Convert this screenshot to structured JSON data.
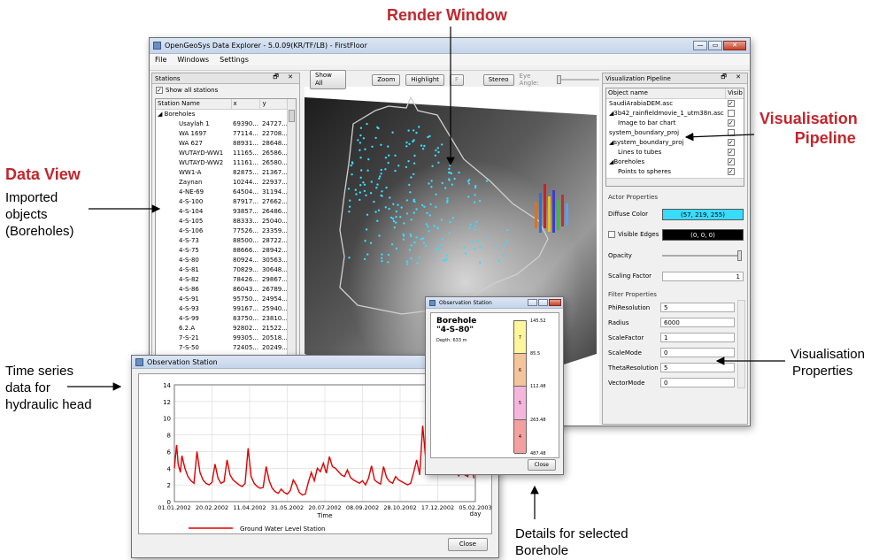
{
  "annotations": {
    "render_window": "Render Window",
    "vis_pipeline_line1": "Visualisation",
    "vis_pipeline_line2": "Pipeline",
    "data_view": "Data View",
    "imported": [
      "Imported",
      "objects",
      "(Boreholes)"
    ],
    "time_series": [
      "Time series",
      "data for",
      "hydraulic head"
    ],
    "vis_properties": [
      "Visualisation",
      "Properties"
    ],
    "details": [
      "Details for selected",
      "Borehole"
    ]
  },
  "main_window": {
    "title": "OpenGeoSys Data Explorer - 5.0.09(KR/TF/LB) - FirstFloor",
    "menu": [
      "File",
      "Windows",
      "Settings"
    ],
    "controls": {
      "minimize": "—",
      "maximize": "▭",
      "close": "✕"
    }
  },
  "stations": {
    "header": "Stations",
    "dock_controls": "🗗 ✕",
    "show_all_label": "Show all stations",
    "columns": [
      "Station Name",
      "x",
      "y"
    ],
    "group": "Boreholes",
    "rows": [
      [
        "Usaylah 1",
        "69390...",
        "24727..."
      ],
      [
        "WA 1697",
        "77114...",
        "22708..."
      ],
      [
        "WA 627",
        "88931...",
        "28648..."
      ],
      [
        "WUTAYD-WW1",
        "11165...",
        "26586..."
      ],
      [
        "WUTAYD-WW2",
        "11161...",
        "26580..."
      ],
      [
        "WW1-A",
        "82875...",
        "21367..."
      ],
      [
        "Zaynan",
        "10244...",
        "22937..."
      ],
      [
        "4-NE-69",
        "64504...",
        "31194..."
      ],
      [
        "4-S-100",
        "87917...",
        "27662..."
      ],
      [
        "4-S-104",
        "93857...",
        "26486..."
      ],
      [
        "4-S-105",
        "88333...",
        "25040..."
      ],
      [
        "4-S-106",
        "77526...",
        "23359..."
      ],
      [
        "4-S-73",
        "88500...",
        "28722..."
      ],
      [
        "4-S-75",
        "88666...",
        "28942..."
      ],
      [
        "4-S-80",
        "80924...",
        "30563..."
      ],
      [
        "4-S-81",
        "70829...",
        "30648..."
      ],
      [
        "4-S-82",
        "78426...",
        "29867..."
      ],
      [
        "4-S-86",
        "86043...",
        "26789..."
      ],
      [
        "4-S-91",
        "95750...",
        "24954..."
      ],
      [
        "4-S-93",
        "99167...",
        "25940..."
      ],
      [
        "4-S-99",
        "83750...",
        "23810..."
      ],
      [
        "6.2.A",
        "92802...",
        "21522..."
      ],
      [
        "7-S-21",
        "99305...",
        "20518..."
      ],
      [
        "7-S-50",
        "72405...",
        "20249..."
      ]
    ]
  },
  "toolbar": {
    "show_all": "Show All",
    "zoom": "Zoom",
    "highlight": "Highlight",
    "f": "F",
    "stereo": "Stereo",
    "eye_angle": "Eye Angle:"
  },
  "pipeline": {
    "header": "Visualization Pipeline",
    "dock_controls": "🗗 ✕",
    "columns": [
      "Object name",
      "Visib"
    ],
    "items": [
      {
        "name": "SaudiArabiaDEM.asc",
        "indent": 0,
        "checked": true
      },
      {
        "name": "◢3b42_rainfieldmovie_1_utm38n.asc",
        "indent": 0,
        "checked": false
      },
      {
        "name": "Image to bar chart",
        "indent": 1,
        "checked": true
      },
      {
        "name": "system_boundary_proj",
        "indent": 0,
        "checked": false
      },
      {
        "name": "◢system_boundary_proj",
        "indent": 0,
        "checked": true
      },
      {
        "name": "Lines to tubes",
        "indent": 1,
        "checked": true
      },
      {
        "name": "◢Boreholes",
        "indent": 0,
        "checked": true
      },
      {
        "name": "Points to spheres",
        "indent": 1,
        "checked": true
      }
    ],
    "actor_props": "Actor Properties",
    "diffuse_label": "Diffuse Color",
    "diffuse_value": "(57, 219, 255)",
    "visible_edges_label": "Visible Edges",
    "edges_value": "(0, 0, 0)",
    "opacity_label": "Opacity",
    "scaling_label": "Scaling Factor",
    "scaling_value": "1",
    "filter_props": "Filter Properties",
    "filters": [
      {
        "label": "PhiResolution",
        "value": "5"
      },
      {
        "label": "Radius",
        "value": "6000"
      },
      {
        "label": "ScaleFactor",
        "value": "1"
      },
      {
        "label": "ScaleMode",
        "value": "0"
      },
      {
        "label": "ThetaResolution",
        "value": "5"
      },
      {
        "label": "VectorMode",
        "value": "0"
      }
    ],
    "colors": {
      "diffuse": "#39dbff",
      "edges": "#000000"
    }
  },
  "obs_window": {
    "title": "Observation Station",
    "close": "Close",
    "legend": "Ground Water Level Station"
  },
  "chart_data": {
    "type": "line",
    "title": "",
    "xlabel": "Time",
    "ylabel": "",
    "x_unit_label": "day",
    "x_ticks": [
      "01.01.2002",
      "20.02.2002",
      "11.04.2002",
      "31.05.2002",
      "20.07.2002",
      "08.09.2002",
      "28.10.2002",
      "17.12.2002",
      "05.02.2003"
    ],
    "y_ticks": [
      0,
      2,
      4,
      6,
      8,
      10,
      12,
      14
    ],
    "ylim": [
      0,
      14
    ],
    "xlim": [
      0,
      400
    ],
    "series": [
      {
        "name": "Ground Water Level Station",
        "color": "#e00000",
        "x": [
          0,
          3,
          5,
          8,
          10,
          14,
          18,
          22,
          26,
          30,
          34,
          38,
          42,
          46,
          50,
          54,
          58,
          62,
          66,
          70,
          74,
          78,
          82,
          86,
          90,
          94,
          98,
          102,
          106,
          110,
          114,
          118,
          122,
          126,
          130,
          134,
          138,
          142,
          146,
          150,
          154,
          158,
          162,
          166,
          170,
          174,
          178,
          182,
          186,
          190,
          194,
          198,
          202,
          206,
          210,
          214,
          218,
          222,
          226,
          230,
          234,
          238,
          242,
          246,
          250,
          254,
          258,
          262,
          266,
          270,
          274,
          278,
          282,
          286,
          290,
          294,
          298,
          302,
          306,
          310,
          314,
          318,
          322,
          326,
          330,
          334,
          338,
          342,
          346,
          350,
          354,
          358,
          362,
          366,
          370,
          374,
          378,
          382,
          386,
          390,
          394,
          398
        ],
        "values": [
          4.0,
          6.8,
          4.5,
          3.5,
          5.5,
          4.0,
          3.0,
          2.5,
          2.2,
          6.0,
          3.5,
          2.6,
          2.2,
          2.0,
          2.3,
          4.5,
          2.8,
          2.2,
          2.4,
          5.0,
          3.2,
          2.6,
          2.3,
          2.0,
          1.8,
          2.2,
          6.4,
          3.0,
          2.2,
          1.8,
          1.6,
          1.7,
          4.2,
          2.5,
          1.6,
          1.2,
          1.0,
          1.5,
          1.1,
          0.9,
          1.3,
          2.6,
          2.0,
          1.1,
          0.8,
          0.9,
          2.3,
          3.5,
          2.5,
          4.0,
          3.6,
          4.6,
          3.4,
          5.4,
          4.2,
          4.0,
          3.6,
          3.2,
          3.0,
          3.8,
          2.9,
          2.6,
          2.4,
          2.2,
          2.5,
          2.0,
          2.8,
          4.3,
          2.6,
          2.3,
          2.1,
          4.2,
          2.9,
          2.4,
          2.2,
          3.0,
          2.6,
          2.4,
          2.2,
          2.0,
          2.2,
          3.5,
          5.0,
          3.2,
          9.1,
          5.2,
          4.2,
          3.2,
          7.8,
          4.6,
          3.6,
          6.2,
          4.2,
          3.6,
          3.3,
          3.6,
          3.1,
          4.0,
          3.2,
          3.0,
          5.0,
          2.8
        ]
      }
    ]
  },
  "borehole_window": {
    "title": "Observation Station",
    "name_label": "Borehole",
    "name": "\"4-S-80\"",
    "depth": "Depth: 633 m",
    "close": "Close",
    "layers": [
      {
        "label": "7",
        "color": "#fff59a",
        "top": "145.52"
      },
      {
        "label": "6",
        "color": "#f5c49b",
        "top": "85.5"
      },
      {
        "label": "5",
        "color": "#f6b6dc",
        "top": "112.48"
      },
      {
        "label": "4",
        "color": "#f4a0a0",
        "top": "263.48"
      }
    ],
    "bottom": "487.48"
  }
}
